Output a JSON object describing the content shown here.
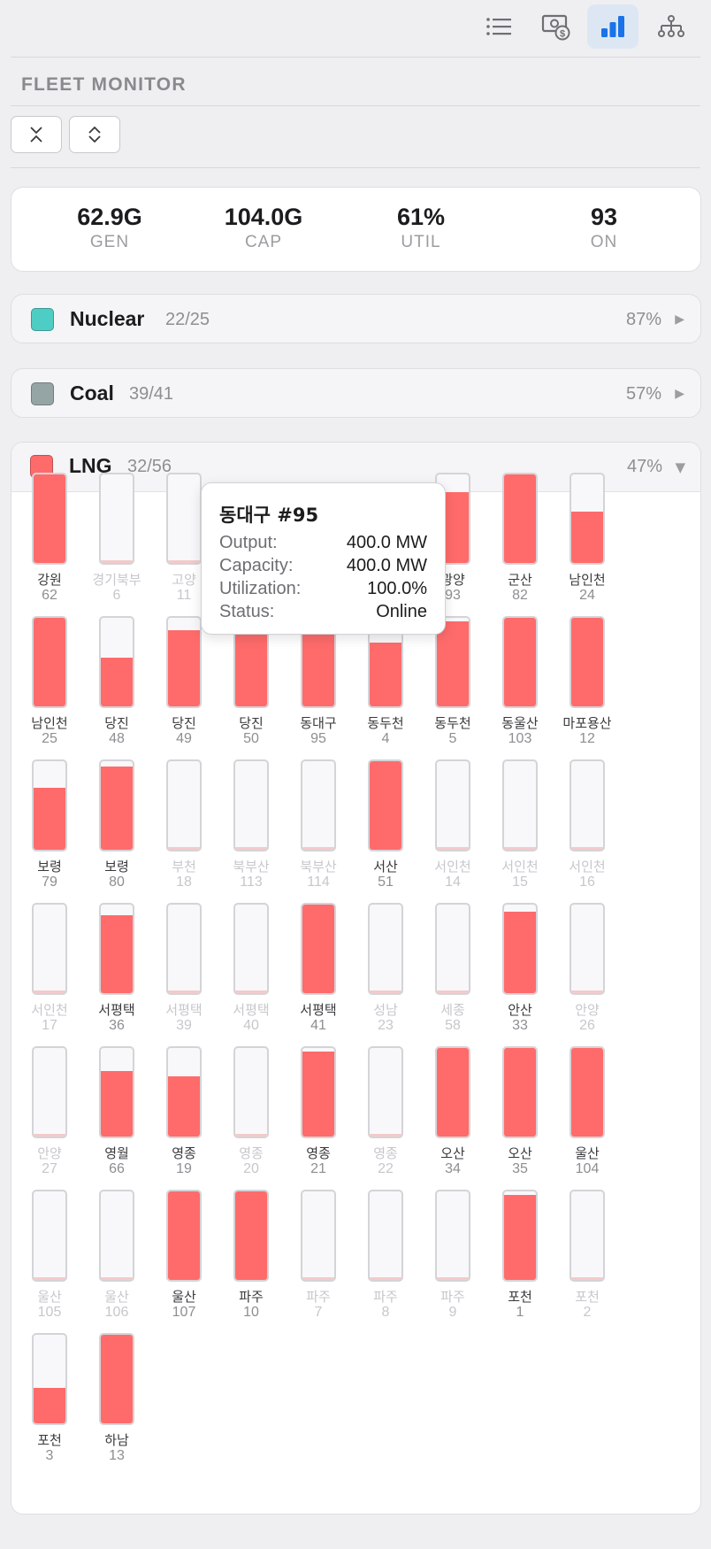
{
  "toolbar": {
    "buttons": [
      {
        "icon": "list-icon",
        "active": false
      },
      {
        "icon": "billing-icon",
        "active": false
      },
      {
        "icon": "bar-chart-icon",
        "active": true
      },
      {
        "icon": "hierarchy-icon",
        "active": false
      }
    ],
    "accent": "#1a73e8"
  },
  "header": {
    "title": "FLEET MONITOR"
  },
  "controls": {
    "collapse_icon": "collapse-all-icon",
    "expand_icon": "expand-all-icon"
  },
  "stats": [
    {
      "value": "62.9G",
      "label": "GEN"
    },
    {
      "value": "104.0G",
      "label": "CAP"
    },
    {
      "value": "61%",
      "label": "UTIL"
    },
    {
      "value": "93",
      "label": "ON"
    }
  ],
  "groups": [
    {
      "name": "Nuclear",
      "count": "22/25",
      "pct": "87%",
      "color": "#4ecdc4",
      "expanded": false
    },
    {
      "name": "Coal",
      "count": "39/41",
      "pct": "57%",
      "color": "#95a5a6",
      "expanded": false
    },
    {
      "name": "LNG",
      "count": "32/56",
      "pct": "47%",
      "color": "#ff6b6b",
      "expanded": true
    }
  ],
  "lng_units": [
    {
      "name": "강원",
      "id": "62",
      "util": 1.0,
      "on": true
    },
    {
      "name": "경기북부",
      "id": "6",
      "util": 0,
      "on": false
    },
    {
      "name": "고양",
      "id": "11",
      "util": 0,
      "on": false
    },
    {
      "name": "",
      "id": "",
      "util": 0,
      "on": false
    },
    {
      "name": "",
      "id": "",
      "util": 0,
      "on": false
    },
    {
      "name": "",
      "id": "",
      "util": 0,
      "on": false
    },
    {
      "name": "광양",
      "id": "93",
      "util": 0.8,
      "on": true
    },
    {
      "name": "군산",
      "id": "82",
      "util": 1.0,
      "on": true
    },
    {
      "name": "남인천",
      "id": "24",
      "util": 0.58,
      "on": true
    },
    {
      "name": "남인천",
      "id": "25",
      "util": 1.0,
      "on": true
    },
    {
      "name": "당진",
      "id": "48",
      "util": 0.55,
      "on": true
    },
    {
      "name": "당진",
      "id": "49",
      "util": 0.86,
      "on": true
    },
    {
      "name": "당진",
      "id": "50",
      "util": 1.0,
      "on": true
    },
    {
      "name": "동대구",
      "id": "95",
      "util": 1.0,
      "on": true
    },
    {
      "name": "동두천",
      "id": "4",
      "util": 0.72,
      "on": true
    },
    {
      "name": "동두천",
      "id": "5",
      "util": 0.96,
      "on": true
    },
    {
      "name": "동울산",
      "id": "103",
      "util": 1.0,
      "on": true
    },
    {
      "name": "마포용산",
      "id": "12",
      "util": 1.0,
      "on": true
    },
    {
      "name": "보령",
      "id": "79",
      "util": 0.7,
      "on": true
    },
    {
      "name": "보령",
      "id": "80",
      "util": 0.94,
      "on": true
    },
    {
      "name": "부천",
      "id": "18",
      "util": 0,
      "on": false
    },
    {
      "name": "북부산",
      "id": "113",
      "util": 0,
      "on": false
    },
    {
      "name": "북부산",
      "id": "114",
      "util": 0,
      "on": false
    },
    {
      "name": "서산",
      "id": "51",
      "util": 1.0,
      "on": true
    },
    {
      "name": "서인천",
      "id": "14",
      "util": 0,
      "on": false
    },
    {
      "name": "서인천",
      "id": "15",
      "util": 0,
      "on": false
    },
    {
      "name": "서인천",
      "id": "16",
      "util": 0,
      "on": false
    },
    {
      "name": "서인천",
      "id": "17",
      "util": 0,
      "on": false
    },
    {
      "name": "서평택",
      "id": "36",
      "util": 0.88,
      "on": true
    },
    {
      "name": "서평택",
      "id": "39",
      "util": 0,
      "on": false
    },
    {
      "name": "서평택",
      "id": "40",
      "util": 0,
      "on": false
    },
    {
      "name": "서평택",
      "id": "41",
      "util": 1.0,
      "on": true
    },
    {
      "name": "성남",
      "id": "23",
      "util": 0,
      "on": false
    },
    {
      "name": "세종",
      "id": "58",
      "util": 0,
      "on": false
    },
    {
      "name": "안산",
      "id": "33",
      "util": 0.92,
      "on": true
    },
    {
      "name": "안양",
      "id": "26",
      "util": 0,
      "on": false
    },
    {
      "name": "안양",
      "id": "27",
      "util": 0,
      "on": false
    },
    {
      "name": "영월",
      "id": "66",
      "util": 0.74,
      "on": true
    },
    {
      "name": "영종",
      "id": "19",
      "util": 0.68,
      "on": true
    },
    {
      "name": "영종",
      "id": "20",
      "util": 0,
      "on": false
    },
    {
      "name": "영종",
      "id": "21",
      "util": 0.96,
      "on": true
    },
    {
      "name": "영종",
      "id": "22",
      "util": 0,
      "on": false
    },
    {
      "name": "오산",
      "id": "34",
      "util": 1.0,
      "on": true
    },
    {
      "name": "오산",
      "id": "35",
      "util": 1.0,
      "on": true
    },
    {
      "name": "울산",
      "id": "104",
      "util": 1.0,
      "on": true
    },
    {
      "name": "울산",
      "id": "105",
      "util": 0,
      "on": false
    },
    {
      "name": "울산",
      "id": "106",
      "util": 0,
      "on": false
    },
    {
      "name": "울산",
      "id": "107",
      "util": 1.0,
      "on": true
    },
    {
      "name": "파주",
      "id": "10",
      "util": 1.0,
      "on": true
    },
    {
      "name": "파주",
      "id": "7",
      "util": 0,
      "on": false
    },
    {
      "name": "파주",
      "id": "8",
      "util": 0,
      "on": false
    },
    {
      "name": "파주",
      "id": "9",
      "util": 0,
      "on": false
    },
    {
      "name": "포천",
      "id": "1",
      "util": 0.96,
      "on": true
    },
    {
      "name": "포천",
      "id": "2",
      "util": 0,
      "on": false
    },
    {
      "name": "포천",
      "id": "3",
      "util": 0.4,
      "on": true
    },
    {
      "name": "하남",
      "id": "13",
      "util": 1.0,
      "on": true
    }
  ],
  "tooltip": {
    "title": "동대구 #95",
    "rows": [
      {
        "key": "Output:",
        "value": "400.0 MW"
      },
      {
        "key": "Capacity:",
        "value": "400.0 MW"
      },
      {
        "key": "Utilization:",
        "value": "100.0%"
      },
      {
        "key": "Status:",
        "value": "Online"
      }
    ]
  },
  "colors": {
    "lng_fill": "#ff6b6b",
    "nuclear": "#4ecdc4",
    "coal": "#95a5a6"
  }
}
